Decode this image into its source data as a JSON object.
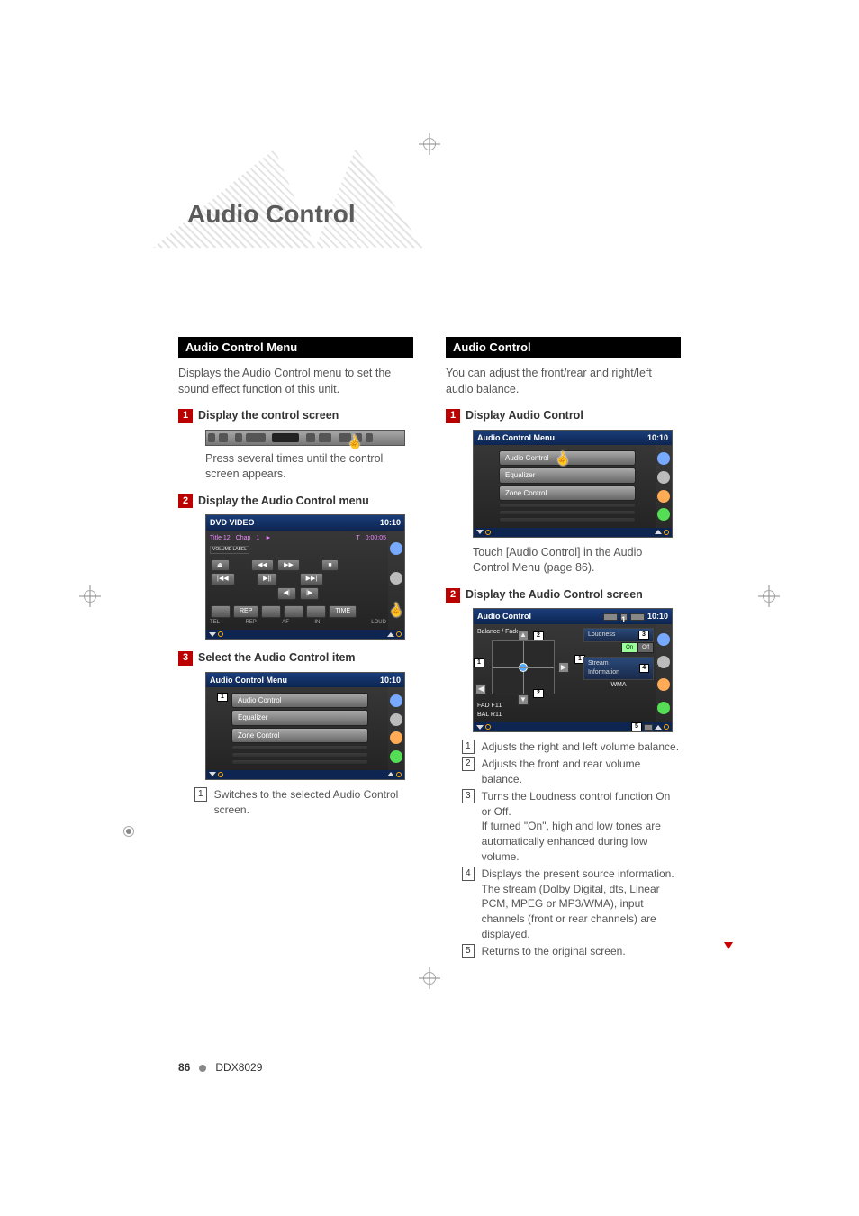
{
  "page_title": "Audio Control",
  "page_number": "86",
  "model": "DDX8029",
  "left": {
    "section_title": "Audio Control Menu",
    "intro": "Displays the Audio Control menu to set the sound effect function of this unit.",
    "step1_label": "Display the control screen",
    "step1_note": "Press several times until the control screen appears.",
    "step2_label": "Display the Audio Control menu",
    "ss_dvd": {
      "title": "DVD VIDEO",
      "time": "10:10",
      "line1_a": "Title 12",
      "line1_b": "Chap",
      "line1_c": "1",
      "line1_d": "►",
      "line1_e": "T",
      "line1_f": "0:00:05",
      "vol": "VOLUME LABEL",
      "btn_eject": "⏏",
      "btn_rew": "◀◀",
      "btn_ff": "▶▶",
      "btn_stop": "■",
      "btn_prev": "|◀◀",
      "btn_play": "▶||",
      "btn_next": "▶▶|",
      "btn_step_b": "◀|",
      "btn_step_f": "|▶",
      "row_labels": [
        "",
        "REP",
        "",
        "",
        "",
        "TIME"
      ],
      "bottom_labels": [
        "TEL",
        "REP",
        "AF",
        "IN",
        "",
        "LOUD"
      ]
    },
    "step3_label": "Select the Audio Control item",
    "ss_menu": {
      "title": "Audio Control Menu",
      "time": "10:10",
      "items": [
        "Audio Control",
        "Equalizer",
        "Zone Control"
      ]
    },
    "callout1": "Switches to the selected Audio Control screen."
  },
  "right": {
    "section_title": "Audio Control",
    "intro": "You can adjust the front/rear and right/left audio balance.",
    "step1_label": "Display Audio Control",
    "ss_menu": {
      "title": "Audio Control Menu",
      "time": "10:10",
      "items": [
        "Audio Control",
        "Equalizer",
        "Zone Control"
      ]
    },
    "note1": "Touch [Audio Control] in the Audio Control Menu (page 86).",
    "step2_label": "Display the Audio Control screen",
    "ss_ac": {
      "title": "Audio Control",
      "time": "10:10",
      "balfad": "Balance / Fader",
      "fad": "FAD F11",
      "bal": "BAL R11",
      "loud": "Loudness",
      "loud_on": "On",
      "loud_off": "Off",
      "stream_lbl": "Stream Information",
      "stream_val": "WMA"
    },
    "callouts": [
      "Adjusts the right and left volume balance.",
      "Adjusts the front and rear volume balance.",
      "Turns the Loudness control function On or Off.\nIf turned \"On\", high and low tones are automatically enhanced during low volume.",
      "Displays the present source information. The stream (Dolby Digital, dts, Linear PCM, MPEG or MP3/WMA), input channels (front or  rear channels) are displayed.",
      "Returns to the original screen."
    ]
  }
}
